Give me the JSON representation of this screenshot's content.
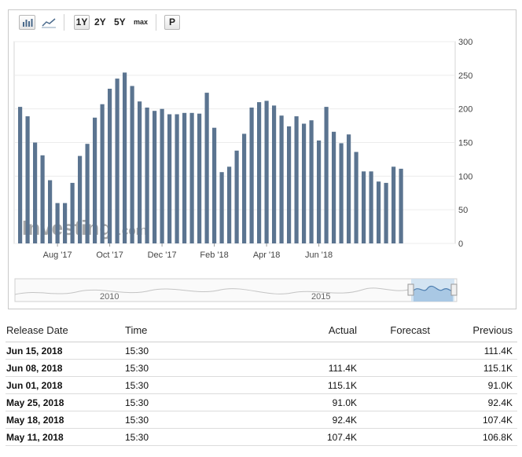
{
  "toolbar": {
    "range_1y": "1Y",
    "range_2y": "2Y",
    "range_5y": "5Y",
    "range_max": "max",
    "print_label": "P"
  },
  "chart_data": {
    "type": "bar",
    "y_ticks": [
      "0",
      "50",
      "100",
      "150",
      "200",
      "250",
      "300"
    ],
    "ylim": [
      0,
      300
    ],
    "x_labels": [
      "Aug '17",
      "Oct '17",
      "Dec '17",
      "Feb '18",
      "Apr '18",
      "Jun '18"
    ],
    "x_label_bar_index": [
      5,
      12,
      19,
      26,
      33,
      40
    ],
    "bar_color": "#5b7490",
    "values": [
      203,
      189,
      150,
      131,
      94,
      60,
      60,
      90,
      130,
      148,
      187,
      207,
      230,
      245,
      254,
      234,
      211,
      202,
      197,
      200,
      192,
      192,
      194,
      194,
      193,
      224,
      172,
      106,
      114,
      138,
      163,
      202,
      210,
      212,
      205,
      190,
      174,
      189,
      178,
      183,
      153,
      203,
      166,
      149,
      162,
      136,
      107,
      107,
      92,
      90,
      114,
      111
    ],
    "watermark": "Investing.com",
    "navigator_labels": [
      "2010",
      "2015"
    ]
  },
  "table": {
    "headers": {
      "date": "Release Date",
      "time": "Time",
      "actual": "Actual",
      "forecast": "Forecast",
      "previous": "Previous"
    },
    "rows": [
      {
        "date": "Jun 15, 2018",
        "time": "15:30",
        "actual": "",
        "forecast": "",
        "previous": "111.4K"
      },
      {
        "date": "Jun 08, 2018",
        "time": "15:30",
        "actual": "111.4K",
        "forecast": "",
        "previous": "115.1K"
      },
      {
        "date": "Jun 01, 2018",
        "time": "15:30",
        "actual": "115.1K",
        "forecast": "",
        "previous": "91.0K"
      },
      {
        "date": "May 25, 2018",
        "time": "15:30",
        "actual": "91.0K",
        "forecast": "",
        "previous": "92.4K"
      },
      {
        "date": "May 18, 2018",
        "time": "15:30",
        "actual": "92.4K",
        "forecast": "",
        "previous": "107.4K"
      },
      {
        "date": "May 11, 2018",
        "time": "15:30",
        "actual": "107.4K",
        "forecast": "",
        "previous": "106.8K"
      }
    ]
  }
}
